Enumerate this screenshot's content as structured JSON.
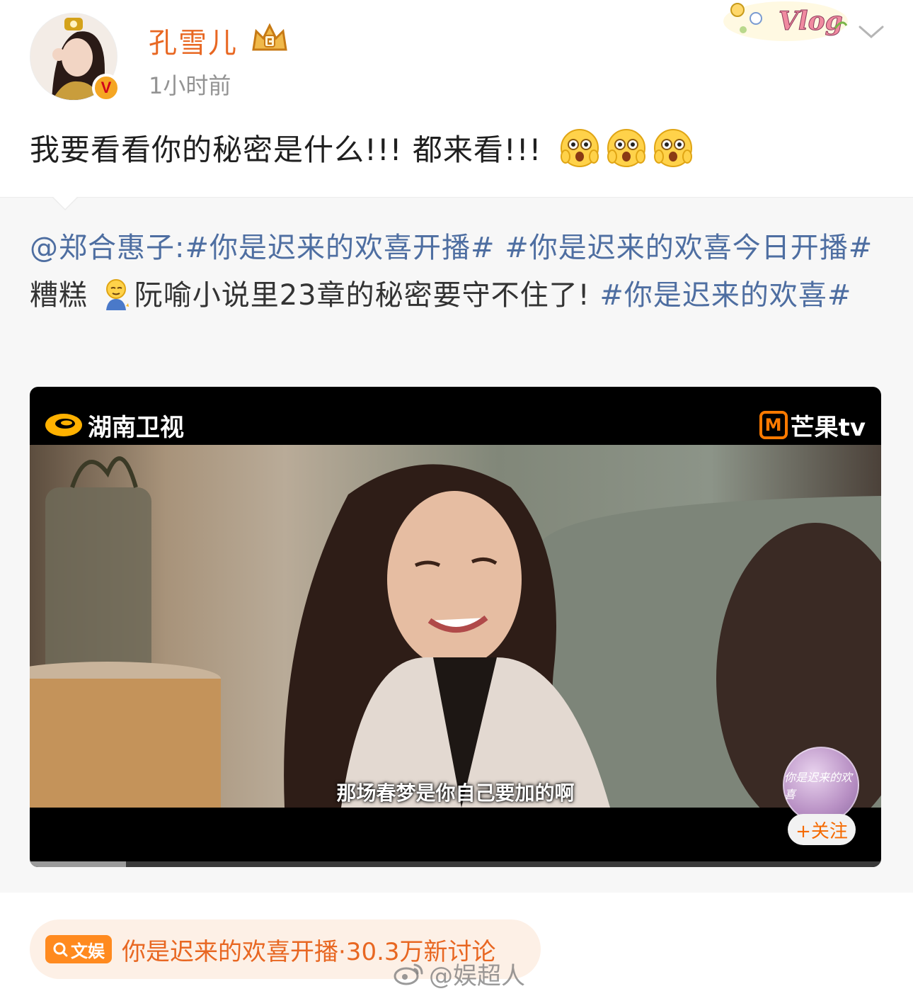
{
  "header": {
    "username": "孔雪儿",
    "time": "1小时前",
    "sticker_text": "Vlog"
  },
  "post": {
    "text": "我要看看你的秘密是什么!!! 都来看!!!"
  },
  "repost": {
    "mention": "@郑合惠子:",
    "hashtag_1": "#你是迟来的欢喜开播#",
    "hashtag_2": "#你是迟来的欢喜今日开播#",
    "text_1": " 糟糕 ",
    "text_2": "阮喻小说里23章的秘密要守不住了! ",
    "hashtag_3": "#你是迟来的欢喜#"
  },
  "video": {
    "channel_logo": "湖南卫视",
    "platform_logo": "芒果tv",
    "subtitle": "那场春梦是你自己要加的啊",
    "show_avatar_text": "你是迟来的欢喜",
    "follow_label": "+关注",
    "progress": 0.113
  },
  "topic": {
    "badge": "文娱",
    "text": "你是迟来的欢喜开播·30.3万新讨论"
  },
  "watermark": "@娱超人",
  "colors": {
    "username": "#e86722",
    "link": "#4e6ea1",
    "topic": "#e86722",
    "badge": "#ff8a1f"
  }
}
